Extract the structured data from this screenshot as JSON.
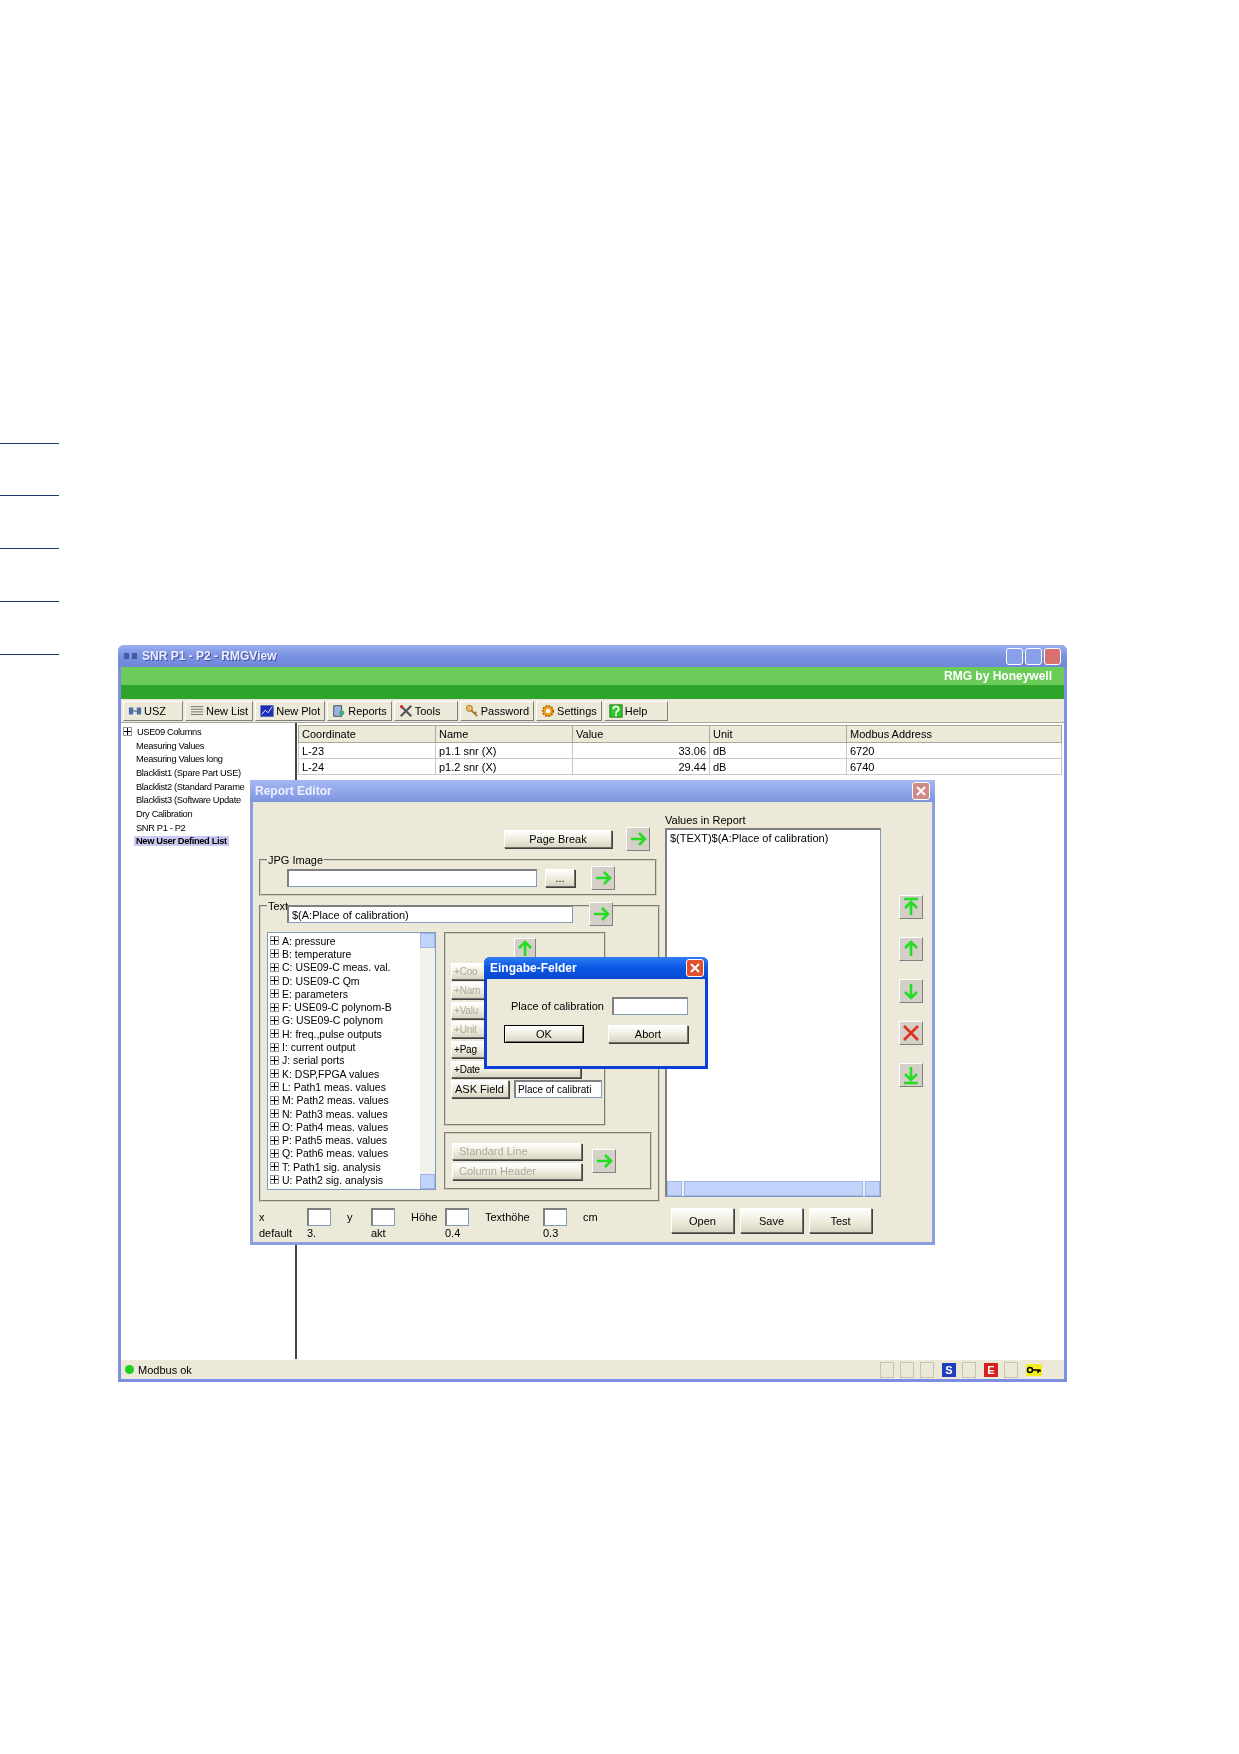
{
  "window": {
    "title": "SNR P1 - P2 - RMGView",
    "brand": "RMG by Honeywell"
  },
  "toolbar": [
    {
      "label": "USZ"
    },
    {
      "label": "New List"
    },
    {
      "label": "New Plot"
    },
    {
      "label": "Reports"
    },
    {
      "label": "Tools"
    },
    {
      "label": "Password"
    },
    {
      "label": "Settings"
    },
    {
      "label": "Help"
    }
  ],
  "tree": [
    {
      "label": "USE09 Columns",
      "kind": "folder",
      "selected": false
    },
    {
      "label": "Measuring Values",
      "kind": "leaf",
      "selected": false
    },
    {
      "label": "Measuring Values long",
      "kind": "leaf",
      "selected": false
    },
    {
      "label": "Blacklist1 (Spare Part USE)",
      "kind": "leaf",
      "selected": false
    },
    {
      "label": "Blacklist2 (Standard Parame",
      "kind": "leaf",
      "selected": false
    },
    {
      "label": "Blacklist3 (Software Update",
      "kind": "leaf",
      "selected": false
    },
    {
      "label": "Dry Calibration",
      "kind": "leaf",
      "selected": false
    },
    {
      "label": "SNR P1 - P2",
      "kind": "leaf",
      "selected": false
    },
    {
      "label": "New User Defined List",
      "kind": "leaf",
      "selected": true
    }
  ],
  "table": {
    "columns": [
      "Coordinate",
      "Name",
      "Value",
      "Unit",
      "Modbus Address"
    ],
    "rows": [
      [
        "L-23",
        "p1.1 snr (X)",
        "33.06",
        "dB",
        "6720"
      ],
      [
        "L-24",
        "p1.2 snr (X)",
        "29.44",
        "dB",
        "6740"
      ]
    ]
  },
  "report_editor": {
    "title": "Report Editor",
    "page_break_button": "Page Break",
    "jpg_group": {
      "label": "JPG Image",
      "browse_button": "..."
    },
    "text_group": {
      "label": "Text",
      "value": "$(A:Place of calibration)"
    },
    "field_tree": [
      {
        "label": "A: pressure"
      },
      {
        "label": "B: temperature"
      },
      {
        "label": "C: USE09-C meas. val."
      },
      {
        "label": "D: USE09-C Qm"
      },
      {
        "label": "E: parameters"
      },
      {
        "label": "F: USE09-C polynom-B"
      },
      {
        "label": "G: USE09-C polynom"
      },
      {
        "label": "H: freq.,pulse outputs"
      },
      {
        "label": "I: current output"
      },
      {
        "label": "J: serial ports"
      },
      {
        "label": "K: DSP,FPGA values"
      },
      {
        "label": "L: Path1 meas. values"
      },
      {
        "label": "M: Path2 meas. values"
      },
      {
        "label": "N: Path3 meas. values"
      },
      {
        "label": "O: Path4 meas. values"
      },
      {
        "label": "P: Path5 meas. values"
      },
      {
        "label": "Q: Path6 meas. values"
      },
      {
        "label": "T: Path1 sig. analysis"
      },
      {
        "label": "U: Path2 sig. analysis"
      }
    ],
    "insert_buttons": [
      {
        "label": "+Coo",
        "disabled": true
      },
      {
        "label": "+Nam",
        "disabled": true
      },
      {
        "label": "+Valu",
        "disabled": true
      },
      {
        "label": "+Unit",
        "disabled": true
      },
      {
        "label": "+Pag",
        "disabled": false
      },
      {
        "label": "+Date",
        "disabled": false
      }
    ],
    "ask_field": {
      "button": "ASK Field",
      "value": "Place of calibrati"
    },
    "line_buttons": [
      {
        "label": "Standard Line",
        "disabled": true
      },
      {
        "label": "Column Header",
        "disabled": true
      }
    ],
    "size_fields": [
      {
        "label": "x",
        "default": "3."
      },
      {
        "label": "y",
        "default": "akt"
      },
      {
        "label": "Höhe",
        "default": "0.4"
      },
      {
        "label": "Texthöhe",
        "default": "0.3"
      }
    ],
    "default_label": "default",
    "unit": "cm",
    "values_label": "Values in Report",
    "values": [
      "$(TEXT)$(A:Place of calibration)"
    ],
    "buttons": [
      "Open",
      "Save",
      "Test"
    ]
  },
  "dialog": {
    "title": "Eingabe-Felder",
    "label": "Place of calibration",
    "buttons": [
      {
        "label": "OK",
        "default": true
      },
      {
        "label": "Abort",
        "default": false
      }
    ]
  },
  "status_bar": {
    "text": "Modbus ok",
    "connected": true,
    "flags": [
      {
        "label": "S",
        "color": "#1f3fbf"
      },
      {
        "label": "E",
        "color": "#d82020"
      }
    ]
  }
}
